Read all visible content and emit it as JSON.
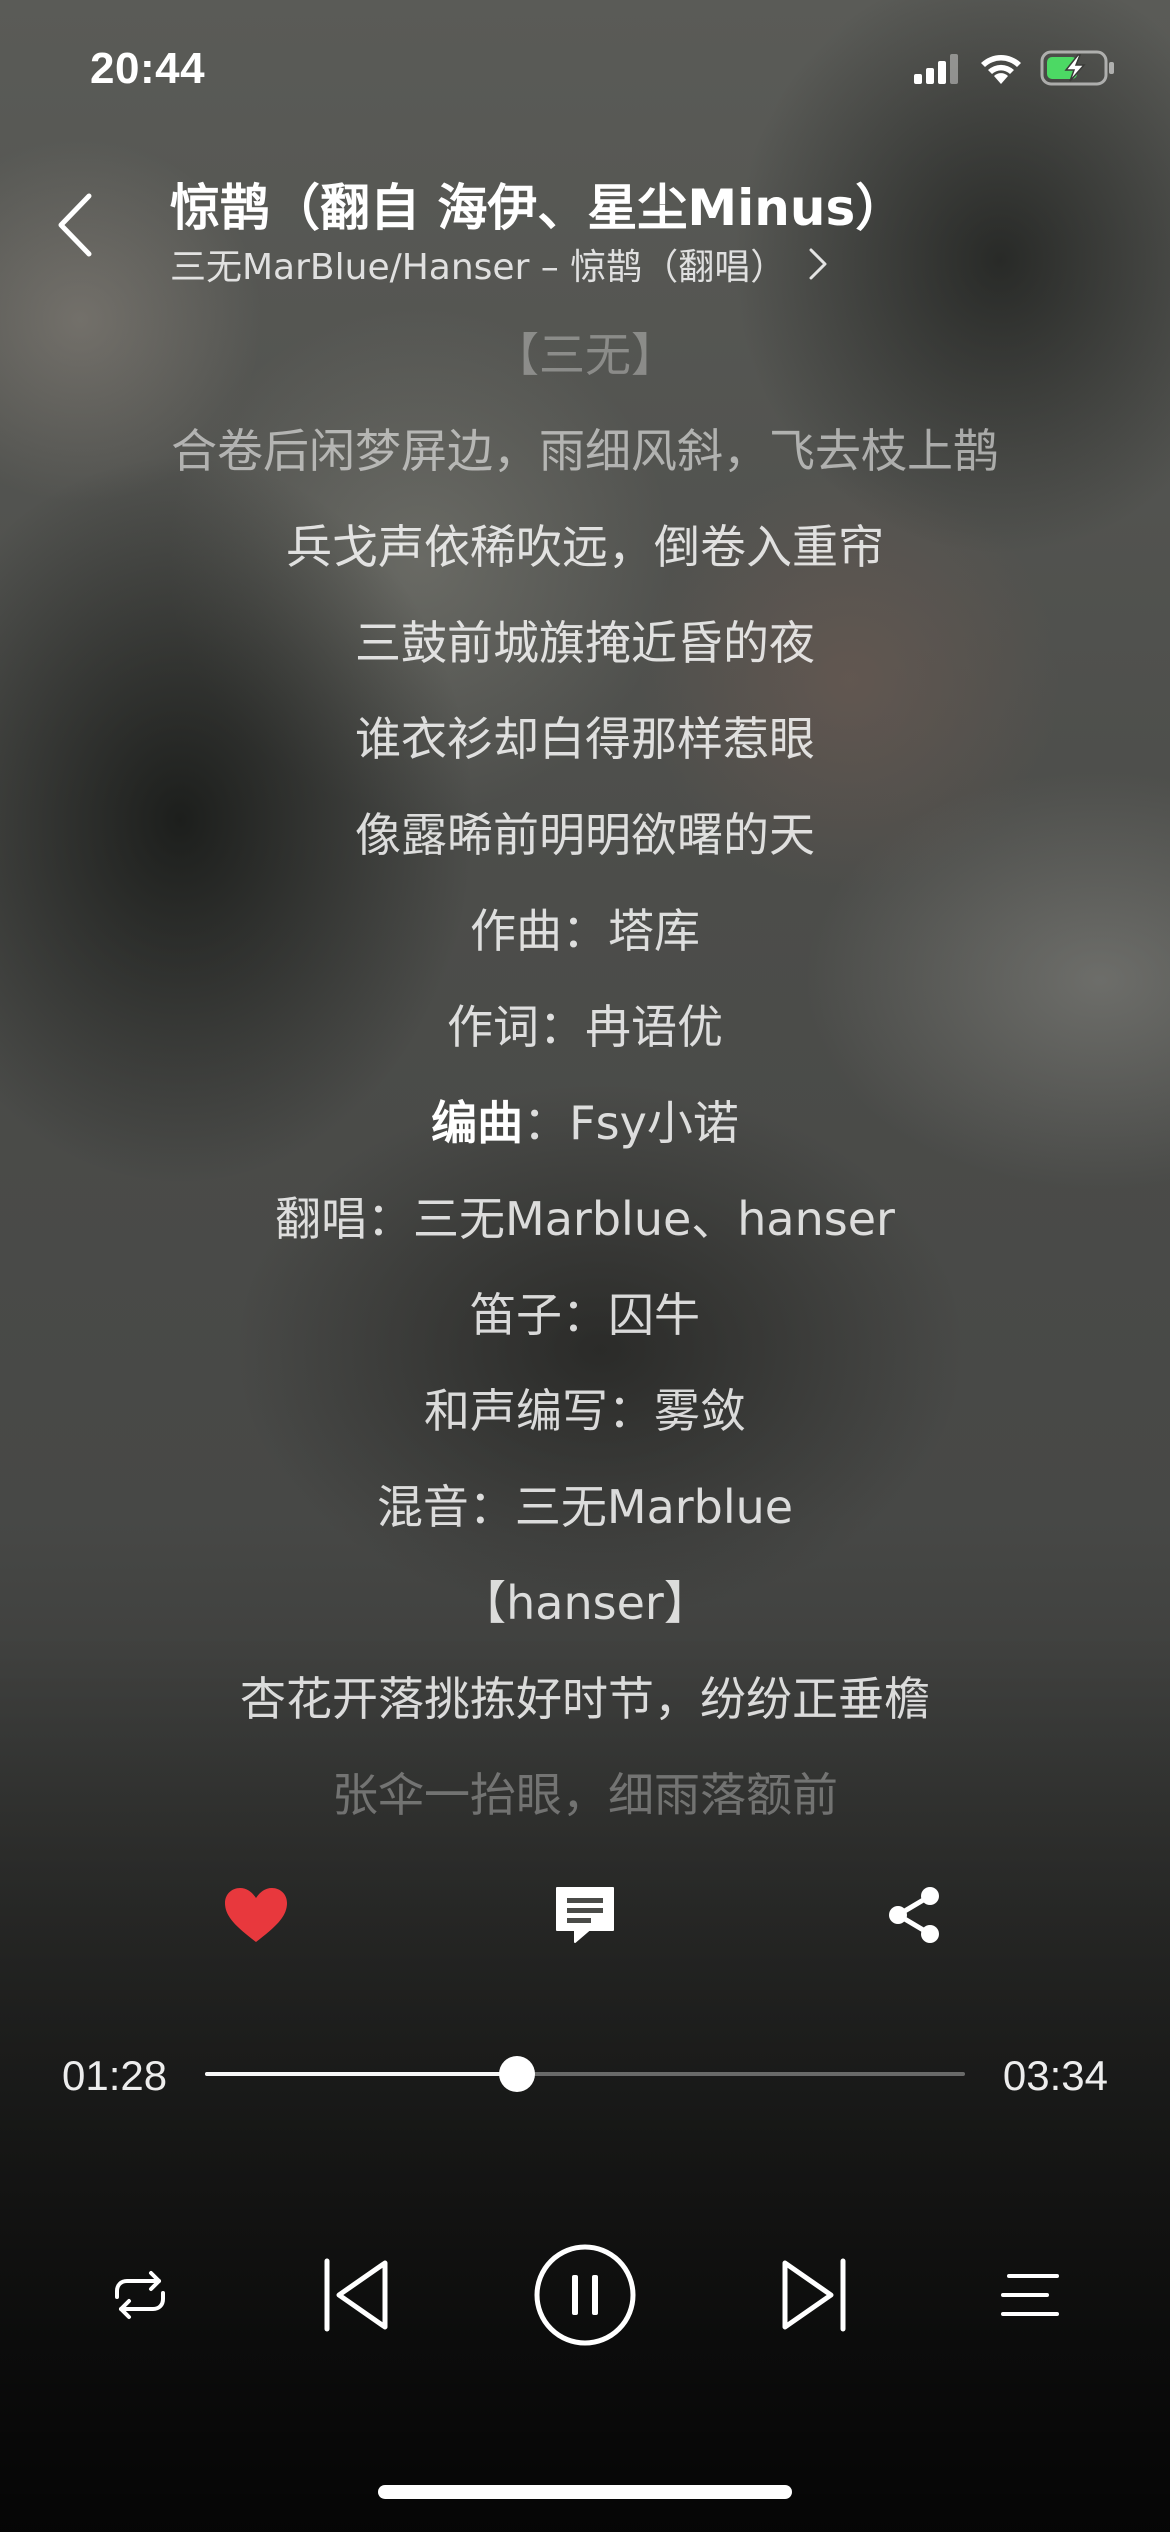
{
  "status_bar": {
    "time": "20:44"
  },
  "header": {
    "title": "惊鹊（翻自 海伊、星尘Minus）",
    "subtitle": "三无MarBlue/Hanser – 惊鹊（翻唱）"
  },
  "lyrics": [
    "【三无】",
    "合卷后闲梦屏边，雨细风斜，飞去枝上鹊",
    "兵戈声依稀吹远，倒卷入重帘",
    "三鼓前城旗掩近昏的夜",
    "谁衣衫却白得那样惹眼",
    "像露晞前明明欲曙的天",
    "作曲：塔库",
    "作词：冉语优",
    "：Fsy小诺",
    "翻唱：三无Marblue、hanser",
    "笛子：囚牛",
    "和声编写：雾敛",
    "混音：三无Marblue",
    "【hanser】",
    "杏花开落挑拣好时节，纷纷正垂檐",
    "张伞一抬眼，细雨落额前"
  ],
  "current_lyric_highlight": "编曲",
  "player": {
    "current_time": "01:28",
    "total_time": "03:34",
    "progress": 0.41,
    "liked": true
  },
  "colors": {
    "like": "#e8383d",
    "text": "#ffffff"
  },
  "icons": {
    "back": "chevron-left-icon",
    "subtitle_more": "chevron-right-icon",
    "like": "heart-icon",
    "comment": "comment-icon",
    "share": "share-icon",
    "repeat": "repeat-icon",
    "previous": "previous-icon",
    "pause": "pause-icon",
    "next": "next-icon",
    "playlist": "playlist-icon"
  }
}
